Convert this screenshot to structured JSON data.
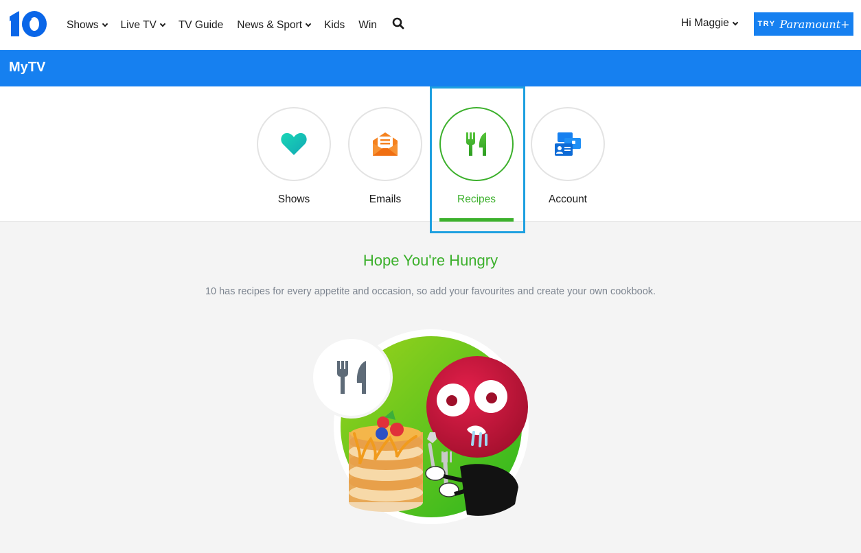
{
  "header": {
    "logo_text": "10",
    "nav": [
      {
        "label": "Shows",
        "dropdown": true
      },
      {
        "label": "Live TV",
        "dropdown": true
      },
      {
        "label": "TV Guide",
        "dropdown": false
      },
      {
        "label": "News & Sport",
        "dropdown": true
      },
      {
        "label": "Kids",
        "dropdown": false
      },
      {
        "label": "Win",
        "dropdown": false
      }
    ],
    "search_icon": "search-icon",
    "user_greeting": "Hi Maggie",
    "cta_try": "TRY",
    "cta_brand": "Paramount+"
  },
  "band": {
    "title": "MyTV"
  },
  "tabs": [
    {
      "label": "Shows",
      "icon": "heart-icon",
      "color": "#18c6b0"
    },
    {
      "label": "Emails",
      "icon": "envelope-icon",
      "color": "#f5821f"
    },
    {
      "label": "Recipes",
      "icon": "cutlery-icon",
      "color": "#3cb02c",
      "active": true
    },
    {
      "label": "Account",
      "icon": "account-cards-icon",
      "color": "#1680f0"
    }
  ],
  "content": {
    "heading": "Hope You're Hungry",
    "subtext": "10 has recipes for every appetite and occasion, so add your favourites and create your own cookbook."
  },
  "colors": {
    "brand_blue": "#1680f0",
    "accent_green": "#3cb02c",
    "focus_outline": "#1ea0e0"
  }
}
